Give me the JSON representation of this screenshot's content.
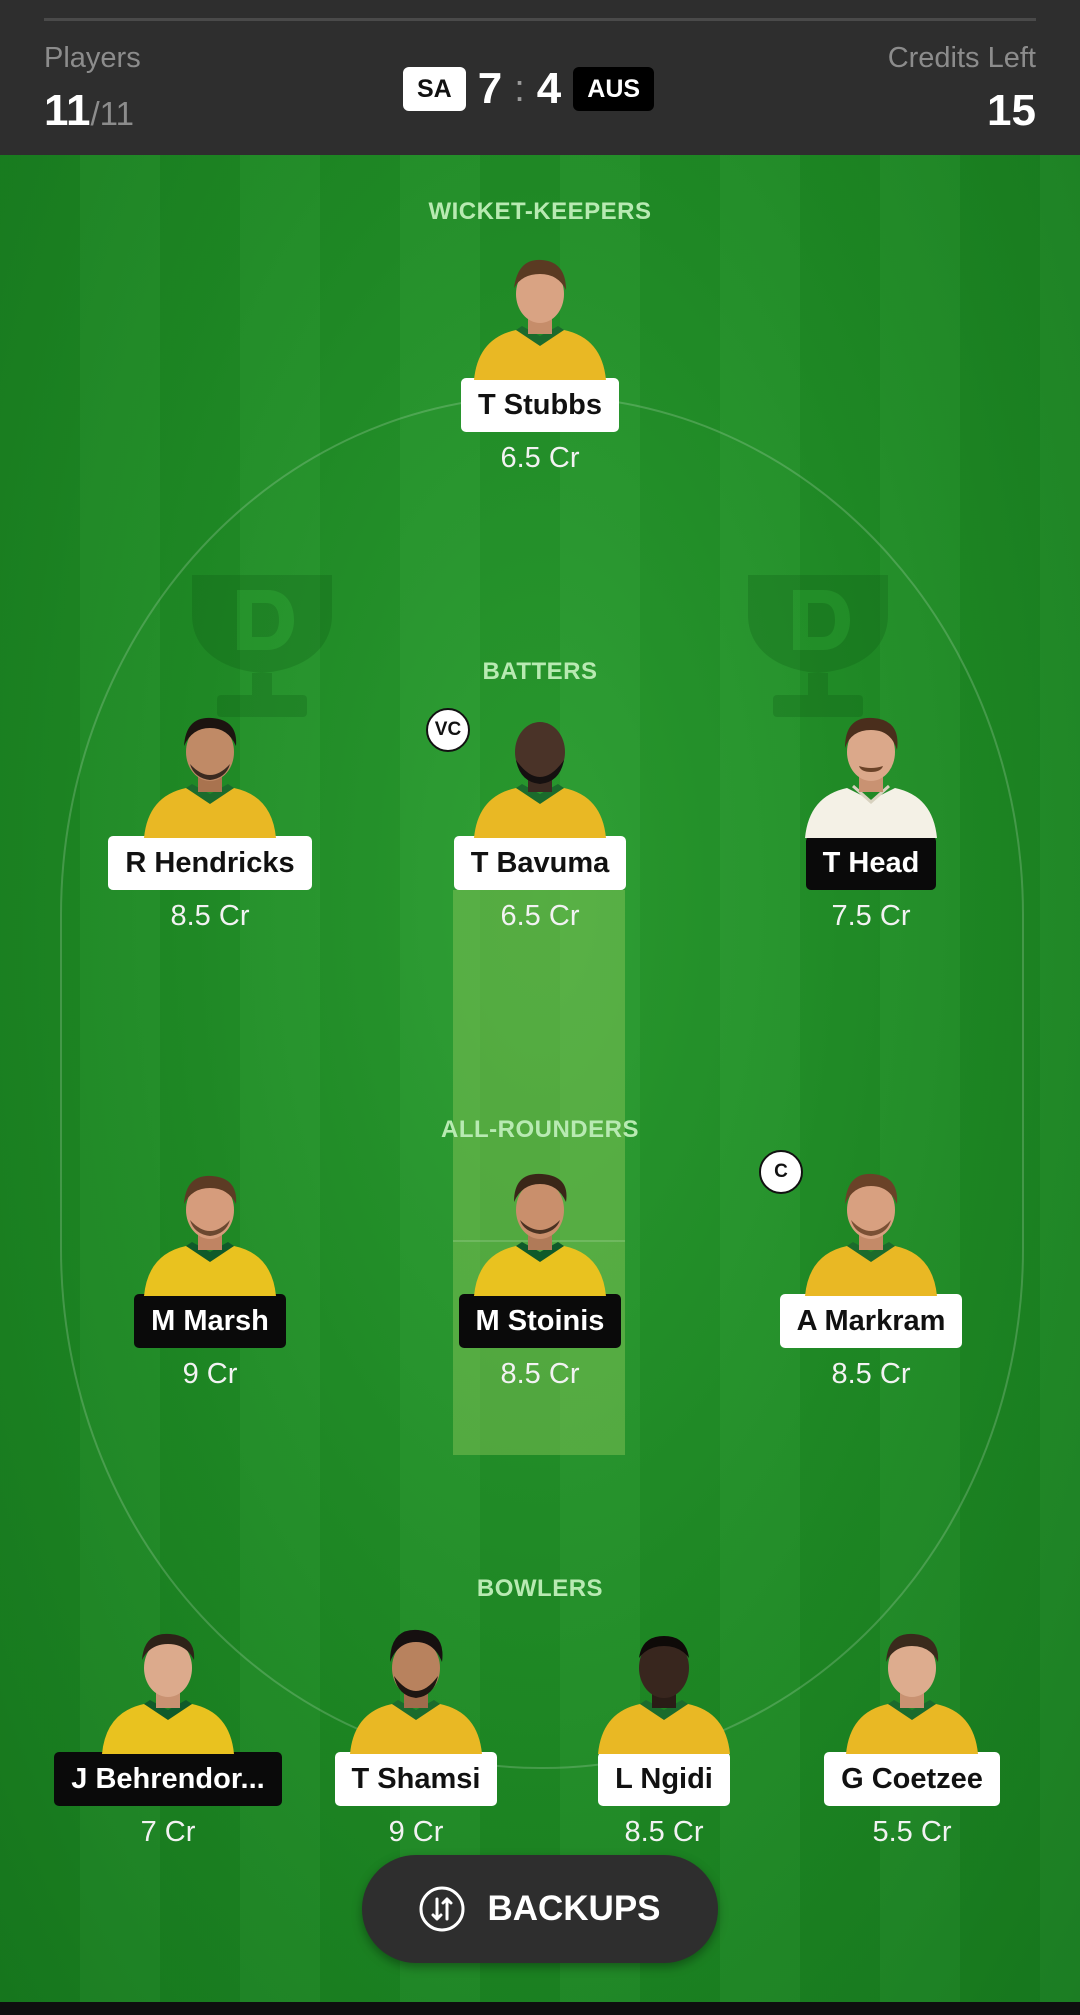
{
  "header": {
    "players_label": "Players",
    "players_count": "11",
    "players_total": "/11",
    "team_left": "SA",
    "team_left_score": "7",
    "score_separator": ":",
    "team_right_score": "4",
    "team_right": "AUS",
    "credits_label": "Credits Left",
    "credits_value": "15"
  },
  "sections": {
    "wicket_keepers": "WICKET-KEEPERS",
    "batters": "BATTERS",
    "all_rounders": "ALL-ROUNDERS",
    "bowlers": "BOWLERS"
  },
  "players": {
    "wk": [
      {
        "name": "T Stubbs",
        "credits": "6.5 Cr",
        "team": "SA"
      }
    ],
    "bat": [
      {
        "name": "R Hendricks",
        "credits": "8.5 Cr",
        "team": "SA"
      },
      {
        "name": "T Bavuma",
        "credits": "6.5 Cr",
        "team": "SA",
        "role": "VC"
      },
      {
        "name": "T Head",
        "credits": "7.5 Cr",
        "team": "AUS"
      }
    ],
    "ar": [
      {
        "name": "M Marsh",
        "credits": "9 Cr",
        "team": "AUS"
      },
      {
        "name": "M Stoinis",
        "credits": "8.5 Cr",
        "team": "AUS"
      },
      {
        "name": "A Markram",
        "credits": "8.5 Cr",
        "team": "SA",
        "role": "C"
      }
    ],
    "bowl": [
      {
        "name": "J Behrendor...",
        "credits": "7 Cr",
        "team": "AUS"
      },
      {
        "name": "T Shamsi",
        "credits": "9 Cr",
        "team": "SA"
      },
      {
        "name": "L Ngidi",
        "credits": "8.5 Cr",
        "team": "SA"
      },
      {
        "name": "G Coetzee",
        "credits": "5.5 Cr",
        "team": "SA"
      }
    ]
  },
  "backups": {
    "label": "BACKUPS",
    "icon": "backups-swap-icon"
  },
  "colors": {
    "field_green": "#1e8a24",
    "section_label": "#b8eab2",
    "header_bg": "#2e2e2e",
    "jersey_sa": "#e9b824",
    "jersey_aus": "#e9c21f",
    "jersey_test": "#f4f1e6"
  }
}
